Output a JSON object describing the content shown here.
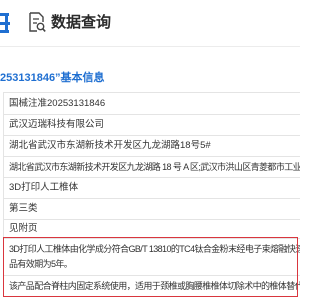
{
  "header": {
    "title": "数据查询",
    "logo_icon": "logo-fragment",
    "query_icon": "document-search-icon"
  },
  "section": {
    "title": "253131846”基本信息"
  },
  "record": {
    "rows": [
      {
        "value": "国械注准20253131846"
      },
      {
        "value": "武汉迈瑞科技有限公司"
      },
      {
        "value": "湖北省武汉市东湖新技术开发区九龙湖路18号5#"
      },
      {
        "value": "湖北省武汉市东湖新技术开发区九龙湖路 18 号 A 区;武汉市洪山区青菱都市工业园"
      },
      {
        "value": "3D打印人工椎体"
      },
      {
        "value": "第三类"
      },
      {
        "value": "见附页"
      }
    ],
    "highlighted": {
      "structure_lines": [
        "3D打印人工椎体由化学成分符合GB/T 13810的TC4钛合金粉末经电子束熔融快速成",
        "品有效期为5年。"
      ],
      "scope": "该产品配合脊柱内固定系统使用，适用于颈椎或胸腰椎椎体切除术中的椎体替代。"
    }
  },
  "colors": {
    "accent": "#1f6fd1",
    "highlight_border": "#d9363e",
    "text": "#333333"
  }
}
